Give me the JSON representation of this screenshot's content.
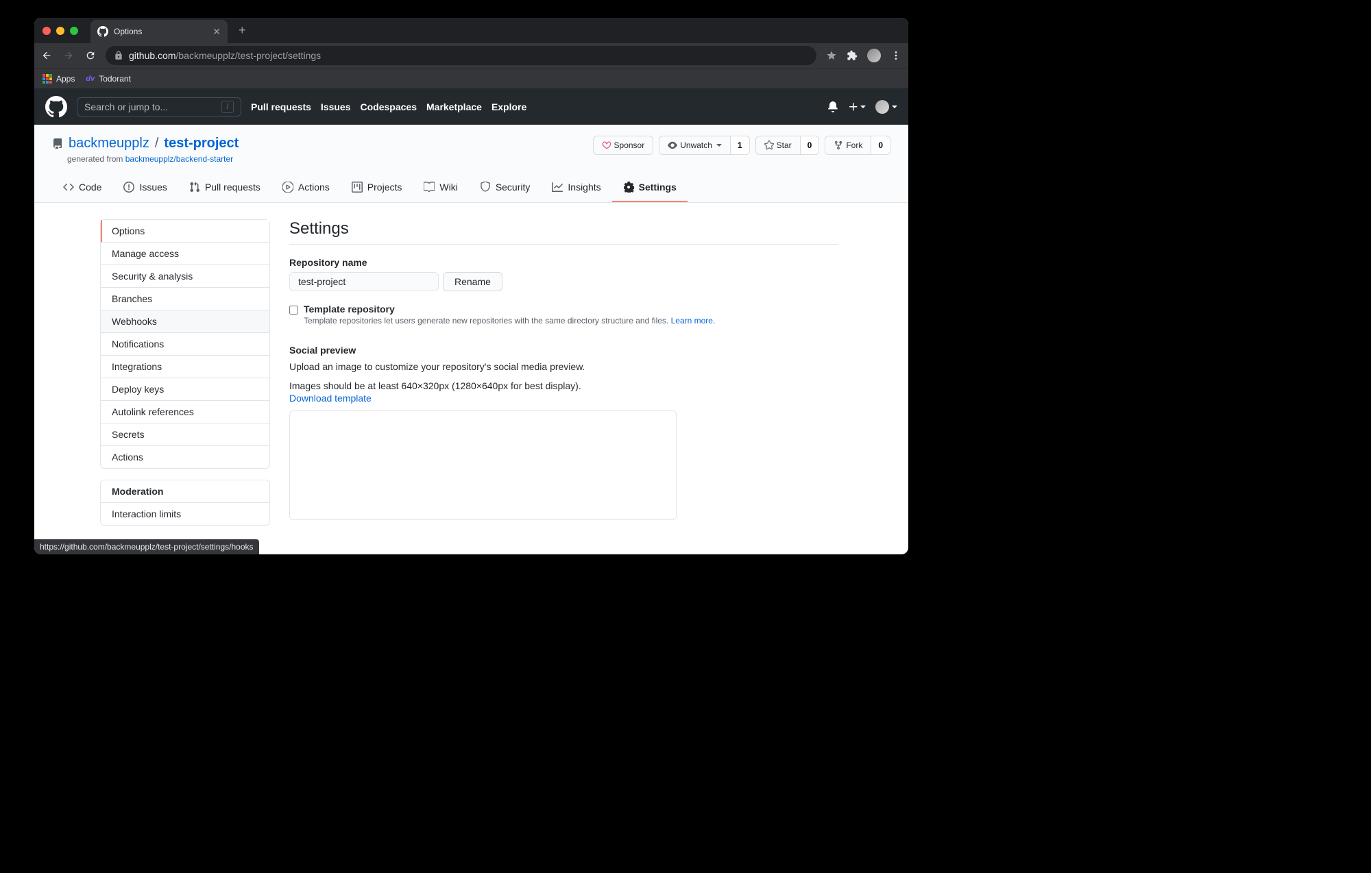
{
  "browser": {
    "tab_title": "Options",
    "url_host": "github.com",
    "url_path": "/backmeupplz/test-project/settings",
    "bookmarks": {
      "apps": "Apps",
      "todorant": "Todorant"
    },
    "status_url": "https://github.com/backmeupplz/test-project/settings/hooks"
  },
  "gh_header": {
    "search_placeholder": "Search or jump to...",
    "nav": [
      "Pull requests",
      "Issues",
      "Codespaces",
      "Marketplace",
      "Explore"
    ]
  },
  "repo": {
    "owner": "backmeupplz",
    "name": "test-project",
    "generated_prefix": "generated from ",
    "generated_link": "backmeupplz/backend-starter",
    "actions": {
      "sponsor": "Sponsor",
      "unwatch": "Unwatch",
      "watch_count": "1",
      "star": "Star",
      "star_count": "0",
      "fork": "Fork",
      "fork_count": "0"
    },
    "tabs": [
      "Code",
      "Issues",
      "Pull requests",
      "Actions",
      "Projects",
      "Wiki",
      "Security",
      "Insights",
      "Settings"
    ]
  },
  "sidebar": {
    "items": [
      "Options",
      "Manage access",
      "Security & analysis",
      "Branches",
      "Webhooks",
      "Notifications",
      "Integrations",
      "Deploy keys",
      "Autolink references",
      "Secrets",
      "Actions"
    ],
    "moderation_heading": "Moderation",
    "moderation_items": [
      "Interaction limits"
    ]
  },
  "settings": {
    "title": "Settings",
    "repo_name_label": "Repository name",
    "repo_name_value": "test-project",
    "rename_btn": "Rename",
    "template_label": "Template repository",
    "template_desc": "Template repositories let users generate new repositories with the same directory structure and files. ",
    "template_learn": "Learn more.",
    "social_title": "Social preview",
    "social_desc1": "Upload an image to customize your repository's social media preview.",
    "social_desc2": "Images should be at least 640×320px (1280×640px for best display).",
    "download_template": "Download template"
  }
}
